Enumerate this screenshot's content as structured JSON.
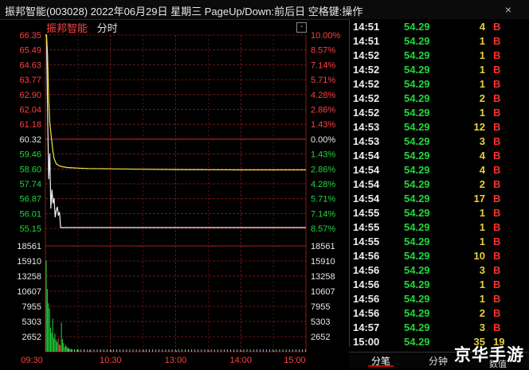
{
  "title_bar": {
    "text": "振邦智能(003028) 2022年06月29日 星期三 PageUp/Down:前后日 空格键:操作",
    "close_glyph": "×"
  },
  "chart_header": {
    "stock_name": "振邦智能",
    "period_label": "分时",
    "minimize_glyph": "-"
  },
  "chart_data": {
    "type": "line",
    "title": "",
    "price_axis": {
      "labels": [
        "66.35",
        "65.49",
        "64.63",
        "63.77",
        "62.90",
        "62.04",
        "61.18",
        "60.32",
        "59.46",
        "58.60",
        "57.74",
        "56.87",
        "56.01",
        "55.15"
      ],
      "pct_labels": [
        "10.00%",
        "8.57%",
        "7.14%",
        "5.71%",
        "4.28%",
        "2.86%",
        "1.43%",
        "0.00%",
        "1.43%",
        "2.86%",
        "4.28%",
        "5.71%",
        "7.14%",
        "8.57%"
      ],
      "ylim": [
        55.15,
        66.35
      ],
      "prev_close": 60.32
    },
    "volume_axis": {
      "labels": [
        "18561",
        "15910",
        "13258",
        "10607",
        "7955",
        "5303",
        "2652"
      ],
      "ylim": [
        0,
        18561
      ]
    },
    "time_labels": [
      "09:30",
      "10:30",
      "13:00",
      "14:00",
      "15:00"
    ],
    "price_series": {
      "name": "",
      "x_minutes": [
        0,
        1,
        2,
        3,
        4,
        5,
        6,
        7,
        8,
        10,
        12,
        14,
        16,
        18,
        20,
        25,
        30,
        40,
        60,
        90,
        120,
        150,
        180,
        210,
        240
      ],
      "values": [
        66.35,
        66.35,
        65.2,
        62.6,
        61.3,
        60.7,
        60.1,
        59.6,
        59.2,
        58.9,
        58.8,
        58.75,
        58.72,
        58.7,
        58.68,
        58.66,
        58.64,
        58.62,
        58.6,
        58.58,
        58.56,
        58.55,
        58.54,
        58.54,
        58.54
      ]
    },
    "avg_series": {
      "name": "",
      "x_minutes": [
        0,
        1,
        2,
        3,
        4,
        5,
        6,
        7,
        8,
        9,
        10,
        11,
        12,
        13,
        14,
        16,
        240
      ],
      "values": [
        66.35,
        66.35,
        62.0,
        58.0,
        59.5,
        56.3,
        57.4,
        56.6,
        56.9,
        55.8,
        56.2,
        56.4,
        55.9,
        56.1,
        55.2,
        55.2,
        55.2
      ]
    },
    "volume_series": {
      "x_minutes": [
        0,
        1,
        2,
        3,
        4,
        5,
        6,
        7,
        8,
        9,
        10,
        11,
        12,
        13,
        14,
        15,
        16,
        17,
        18,
        19,
        20,
        21,
        22,
        24,
        26,
        28,
        30,
        35,
        40,
        50,
        60,
        90,
        120,
        150,
        180,
        210,
        239
      ],
      "values": [
        16000,
        11000,
        8500,
        7600,
        4200,
        3300,
        5800,
        2400,
        3200,
        2100,
        1700,
        2300,
        1300,
        1100,
        5100,
        2200,
        1500,
        800,
        1200,
        900,
        700,
        600,
        500,
        450,
        400,
        380,
        360,
        320,
        300,
        280,
        260,
        220,
        200,
        180,
        170,
        160,
        150
      ]
    }
  },
  "ticks": [
    {
      "time": "14:51",
      "price": "54.29",
      "vol": "4",
      "bs": "B"
    },
    {
      "time": "14:51",
      "price": "54.29",
      "vol": "1",
      "bs": "B"
    },
    {
      "time": "14:52",
      "price": "54.29",
      "vol": "1",
      "bs": "B"
    },
    {
      "time": "14:52",
      "price": "54.29",
      "vol": "1",
      "bs": "B"
    },
    {
      "time": "14:52",
      "price": "54.29",
      "vol": "1",
      "bs": "B"
    },
    {
      "time": "14:52",
      "price": "54.29",
      "vol": "2",
      "bs": "B"
    },
    {
      "time": "14:52",
      "price": "54.29",
      "vol": "1",
      "bs": "B"
    },
    {
      "time": "14:53",
      "price": "54.29",
      "vol": "12",
      "bs": "B"
    },
    {
      "time": "14:53",
      "price": "54.29",
      "vol": "3",
      "bs": "B"
    },
    {
      "time": "14:54",
      "price": "54.29",
      "vol": "4",
      "bs": "B"
    },
    {
      "time": "14:54",
      "price": "54.29",
      "vol": "4",
      "bs": "B"
    },
    {
      "time": "14:54",
      "price": "54.29",
      "vol": "2",
      "bs": "B"
    },
    {
      "time": "14:54",
      "price": "54.29",
      "vol": "17",
      "bs": "B"
    },
    {
      "time": "14:55",
      "price": "54.29",
      "vol": "1",
      "bs": "B"
    },
    {
      "time": "14:55",
      "price": "54.29",
      "vol": "1",
      "bs": "B"
    },
    {
      "time": "14:55",
      "price": "54.29",
      "vol": "1",
      "bs": "B"
    },
    {
      "time": "14:56",
      "price": "54.29",
      "vol": "10",
      "bs": "B"
    },
    {
      "time": "14:56",
      "price": "54.29",
      "vol": "3",
      "bs": "B"
    },
    {
      "time": "14:56",
      "price": "54.29",
      "vol": "1",
      "bs": "B"
    },
    {
      "time": "14:56",
      "price": "54.29",
      "vol": "1",
      "bs": "B"
    },
    {
      "time": "14:56",
      "price": "54.29",
      "vol": "2",
      "bs": "B"
    },
    {
      "time": "14:57",
      "price": "54.29",
      "vol": "3",
      "bs": "B"
    },
    {
      "time": "15:00",
      "price": "54.29",
      "vol": "35",
      "bs": "19"
    }
  ],
  "right_tabs": {
    "tab1": "分笔",
    "tab2": "分钟",
    "tab3": "数值"
  },
  "watermark": "京华手游",
  "colors": {
    "grid": "#8a1a1a",
    "up": "#ff4040",
    "down": "#22d63c",
    "price_line": "#f0f0f0",
    "avg_line": "#f5e642",
    "volume": "#22d63c",
    "volume_up": "#ff4040"
  }
}
